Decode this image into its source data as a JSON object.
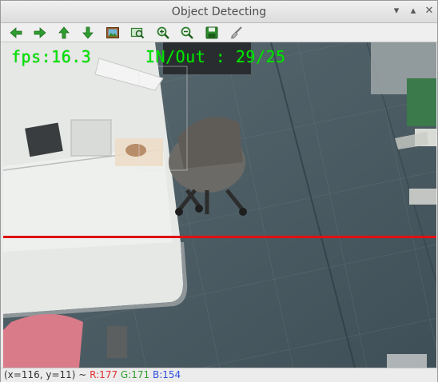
{
  "window": {
    "title": "Object Detecting"
  },
  "window_controls": {
    "minimize_icon": "chevron-down-icon",
    "maximize_icon": "chevron-up-icon",
    "close_icon": "close-icon",
    "minimize_glyph": "▾",
    "maximize_glyph": "▴",
    "close_glyph": "✕"
  },
  "toolbar": {
    "buttons": [
      {
        "name": "pan-left",
        "icon": "arrow-left-icon"
      },
      {
        "name": "pan-right",
        "icon": "arrow-right-icon"
      },
      {
        "name": "pan-up",
        "icon": "arrow-up-icon"
      },
      {
        "name": "pan-down",
        "icon": "arrow-down-icon"
      },
      {
        "name": "zoom-to-fit",
        "icon": "image-icon"
      },
      {
        "name": "zoom-rect",
        "icon": "zoom-rect-icon"
      },
      {
        "name": "zoom-in",
        "icon": "zoom-in-icon"
      },
      {
        "name": "zoom-out",
        "icon": "zoom-out-icon"
      },
      {
        "name": "save",
        "icon": "save-icon"
      },
      {
        "name": "properties",
        "icon": "brush-icon"
      }
    ]
  },
  "overlay": {
    "fps_text": "fps:16.3",
    "inout_text": "IN/Out : 29/25",
    "text_color": "#00e400",
    "line_color": "#e01010"
  },
  "status": {
    "coords": "(x=116, y=11) ~ ",
    "r": "R:177",
    "g": "G:171",
    "b": "B:154"
  },
  "colors": {
    "accent_green": "#2f9d2f",
    "red": "#e03030"
  }
}
